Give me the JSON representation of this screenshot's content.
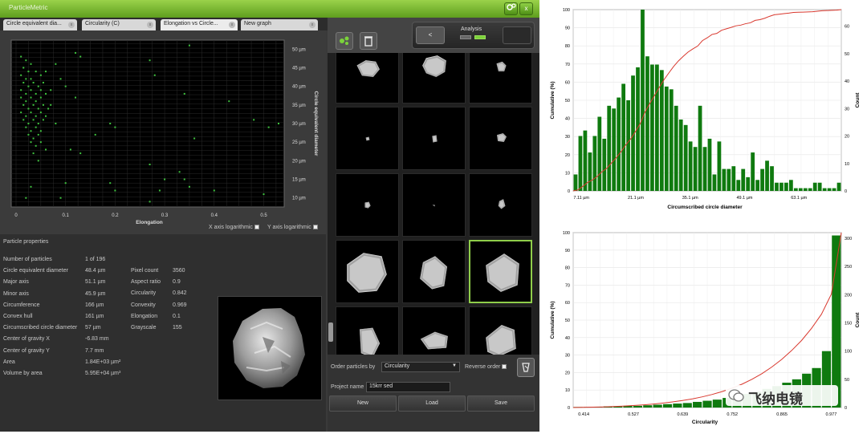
{
  "app": {
    "title": "ParticleMetric"
  },
  "tabs": [
    {
      "label": "Circle equivalent dia..."
    },
    {
      "label": "Circularity (C)"
    },
    {
      "label": "Elongation vs Circle..."
    },
    {
      "label": "New graph"
    }
  ],
  "scatter": {
    "xlabel": "Elongation",
    "ylabel": "Circle equivalent diameter",
    "xticks": [
      "0",
      "0.1",
      "0.2",
      "0.3",
      "0.4",
      "0.5"
    ],
    "yticks": [
      "10 µm",
      "15 µm",
      "20 µm",
      "25 µm",
      "30 µm",
      "35 µm",
      "40 µm",
      "45 µm",
      "50 µm"
    ],
    "xlog_label": "X axis logarithmic",
    "ylog_label": "Y axis logarithmic",
    "point_color": "#3ec23e"
  },
  "toolbar": {
    "back_label": "<",
    "analysis_label": "Analysis"
  },
  "properties": {
    "header": "Particle properties",
    "left": [
      {
        "label": "Number of particles",
        "value": "1 of 196"
      },
      {
        "label": "Circle equivalent diameter",
        "value": "48.4 µm"
      },
      {
        "label": "Major axis",
        "value": "51.1 µm"
      },
      {
        "label": "Minor axis",
        "value": "45.9 µm"
      },
      {
        "label": "Circumference",
        "value": "166 µm"
      },
      {
        "label": "Convex hull",
        "value": "161 µm"
      },
      {
        "label": "Circumscribed circle diameter",
        "value": "57 µm"
      },
      {
        "label": "Center of gravity X",
        "value": "-6.83 mm"
      },
      {
        "label": "Center of gravity Y",
        "value": "7.7 mm"
      },
      {
        "label": "Area",
        "value": "1.84E+03 µm²"
      },
      {
        "label": "Volume by area",
        "value": "5.95E+04 µm³"
      }
    ],
    "right": [
      {
        "label": "Pixel count",
        "value": "3560"
      },
      {
        "label": "Aspect ratio",
        "value": "0.9"
      },
      {
        "label": "Circularity",
        "value": "0.842"
      },
      {
        "label": "Convexity",
        "value": "0.969"
      },
      {
        "label": "Elongation",
        "value": "0.1"
      },
      {
        "label": "Grayscale",
        "value": "155"
      }
    ]
  },
  "controls": {
    "order_label": "Order particles by",
    "order_value": "Circularity",
    "reverse_label": "Reverse order",
    "project_label": "Project name",
    "project_value": "15krr sed",
    "new_label": "New",
    "load_label": "Load",
    "save_label": "Save"
  },
  "hist1": {
    "xlabel": "Circumscribed circle diameter",
    "ylabel_left": "Cumulative (%)",
    "ylabel_right": "Count",
    "xticks": [
      "7.11 µm",
      "21.1 µm",
      "35.1 µm",
      "49.1 µm",
      "63.1 µm"
    ],
    "yleft": [
      "0",
      "10",
      "20",
      "30",
      "40",
      "50",
      "60",
      "70",
      "80",
      "90",
      "100"
    ],
    "yright": [
      "0",
      "10",
      "20",
      "30",
      "40",
      "50",
      "60"
    ]
  },
  "hist2": {
    "xlabel": "Circularity",
    "ylabel_left": "Cumulative (%)",
    "ylabel_right": "Count",
    "xticks": [
      "0.414",
      "0.527",
      "0.639",
      "0.752",
      "0.865",
      "0.977"
    ],
    "yleft": [
      "0",
      "10",
      "20",
      "30",
      "40",
      "50",
      "60",
      "70",
      "80",
      "90",
      "100"
    ],
    "yright": [
      "0",
      "50",
      "100",
      "150",
      "200",
      "250",
      "300"
    ]
  },
  "watermark": {
    "text": "飞纳电镜"
  },
  "chart_data": [
    {
      "type": "scatter",
      "title": "",
      "xlabel": "Elongation",
      "ylabel": "Circle equivalent diameter",
      "xlim": [
        0,
        0.53
      ],
      "ylim": [
        8,
        52
      ],
      "unit": "µm",
      "points": [
        [
          0.01,
          48
        ],
        [
          0.02,
          47
        ],
        [
          0.03,
          46
        ],
        [
          0.015,
          45
        ],
        [
          0.025,
          44
        ],
        [
          0.04,
          44
        ],
        [
          0.01,
          43
        ],
        [
          0.02,
          42
        ],
        [
          0.03,
          42
        ],
        [
          0.05,
          43
        ],
        [
          0.06,
          44
        ],
        [
          0.015,
          41
        ],
        [
          0.025,
          40
        ],
        [
          0.035,
          41
        ],
        [
          0.045,
          40
        ],
        [
          0.055,
          41
        ],
        [
          0.01,
          39
        ],
        [
          0.02,
          38
        ],
        [
          0.03,
          39
        ],
        [
          0.04,
          38
        ],
        [
          0.05,
          39
        ],
        [
          0.06,
          38
        ],
        [
          0.07,
          39
        ],
        [
          0.01,
          37
        ],
        [
          0.02,
          36
        ],
        [
          0.03,
          37
        ],
        [
          0.04,
          36
        ],
        [
          0.05,
          37
        ],
        [
          0.015,
          35
        ],
        [
          0.025,
          34
        ],
        [
          0.035,
          35
        ],
        [
          0.045,
          34
        ],
        [
          0.055,
          35
        ],
        [
          0.065,
          34
        ],
        [
          0.01,
          33
        ],
        [
          0.02,
          32
        ],
        [
          0.03,
          33
        ],
        [
          0.04,
          32
        ],
        [
          0.05,
          33
        ],
        [
          0.06,
          32
        ],
        [
          0.015,
          31
        ],
        [
          0.025,
          30
        ],
        [
          0.035,
          31
        ],
        [
          0.045,
          30
        ],
        [
          0.055,
          31
        ],
        [
          0.02,
          29
        ],
        [
          0.03,
          28
        ],
        [
          0.04,
          29
        ],
        [
          0.05,
          28
        ],
        [
          0.025,
          27
        ],
        [
          0.035,
          26
        ],
        [
          0.045,
          27
        ],
        [
          0.03,
          25
        ],
        [
          0.04,
          24
        ],
        [
          0.05,
          25
        ],
        [
          0.06,
          23
        ],
        [
          0.035,
          22
        ],
        [
          0.045,
          20
        ],
        [
          0.08,
          46
        ],
        [
          0.09,
          42
        ],
        [
          0.1,
          40
        ],
        [
          0.12,
          37
        ],
        [
          0.13,
          48
        ],
        [
          0.12,
          49
        ],
        [
          0.07,
          35
        ],
        [
          0.08,
          30
        ],
        [
          0.19,
          30
        ],
        [
          0.2,
          29
        ],
        [
          0.13,
          22
        ],
        [
          0.27,
          47
        ],
        [
          0.28,
          43
        ],
        [
          0.35,
          51
        ],
        [
          0.34,
          38
        ],
        [
          0.43,
          36
        ],
        [
          0.53,
          30
        ],
        [
          0.51,
          29
        ],
        [
          0.48,
          31
        ],
        [
          0.36,
          26
        ],
        [
          0.27,
          19
        ],
        [
          0.33,
          17
        ],
        [
          0.34,
          15
        ],
        [
          0.35,
          13
        ],
        [
          0.3,
          15
        ],
        [
          0.29,
          12
        ],
        [
          0.19,
          14
        ],
        [
          0.2,
          12
        ],
        [
          0.27,
          9
        ],
        [
          0.1,
          14
        ],
        [
          0.09,
          10
        ],
        [
          0.4,
          12
        ],
        [
          0.5,
          11
        ],
        [
          0.03,
          13
        ],
        [
          0.02,
          10
        ],
        [
          0.11,
          23
        ],
        [
          0.16,
          27
        ]
      ]
    },
    {
      "type": "bar",
      "title": "",
      "xlabel": "Circumscribed circle diameter",
      "ylabel": "Count",
      "cumulative_label": "Cumulative (%)",
      "xlim": [
        5,
        74
      ],
      "ylim": [
        0,
        66
      ],
      "values": [
        6,
        20,
        22,
        14,
        20,
        27,
        19,
        31,
        30,
        34,
        39,
        33,
        42,
        45,
        66,
        49,
        46,
        46,
        44,
        38,
        37,
        31,
        26,
        24,
        18,
        16,
        31,
        16,
        19,
        6,
        18,
        8,
        8,
        9,
        4,
        8,
        5,
        14,
        4,
        8,
        11,
        9,
        3,
        3,
        3,
        4,
        1,
        1,
        1,
        1,
        3,
        3,
        1,
        1,
        1,
        3
      ]
    },
    {
      "type": "bar",
      "title": "",
      "xlabel": "Circularity",
      "ylabel": "Count",
      "cumulative_label": "Cumulative (%)",
      "xlim": [
        0.39,
        1.0
      ],
      "ylim": [
        0,
        310
      ],
      "values": [
        1,
        1,
        1,
        2,
        2,
        3,
        3,
        4,
        5,
        6,
        7,
        8,
        10,
        12,
        14,
        17,
        20,
        24,
        28,
        33,
        38,
        44,
        50,
        60,
        70,
        100,
        305
      ]
    }
  ]
}
